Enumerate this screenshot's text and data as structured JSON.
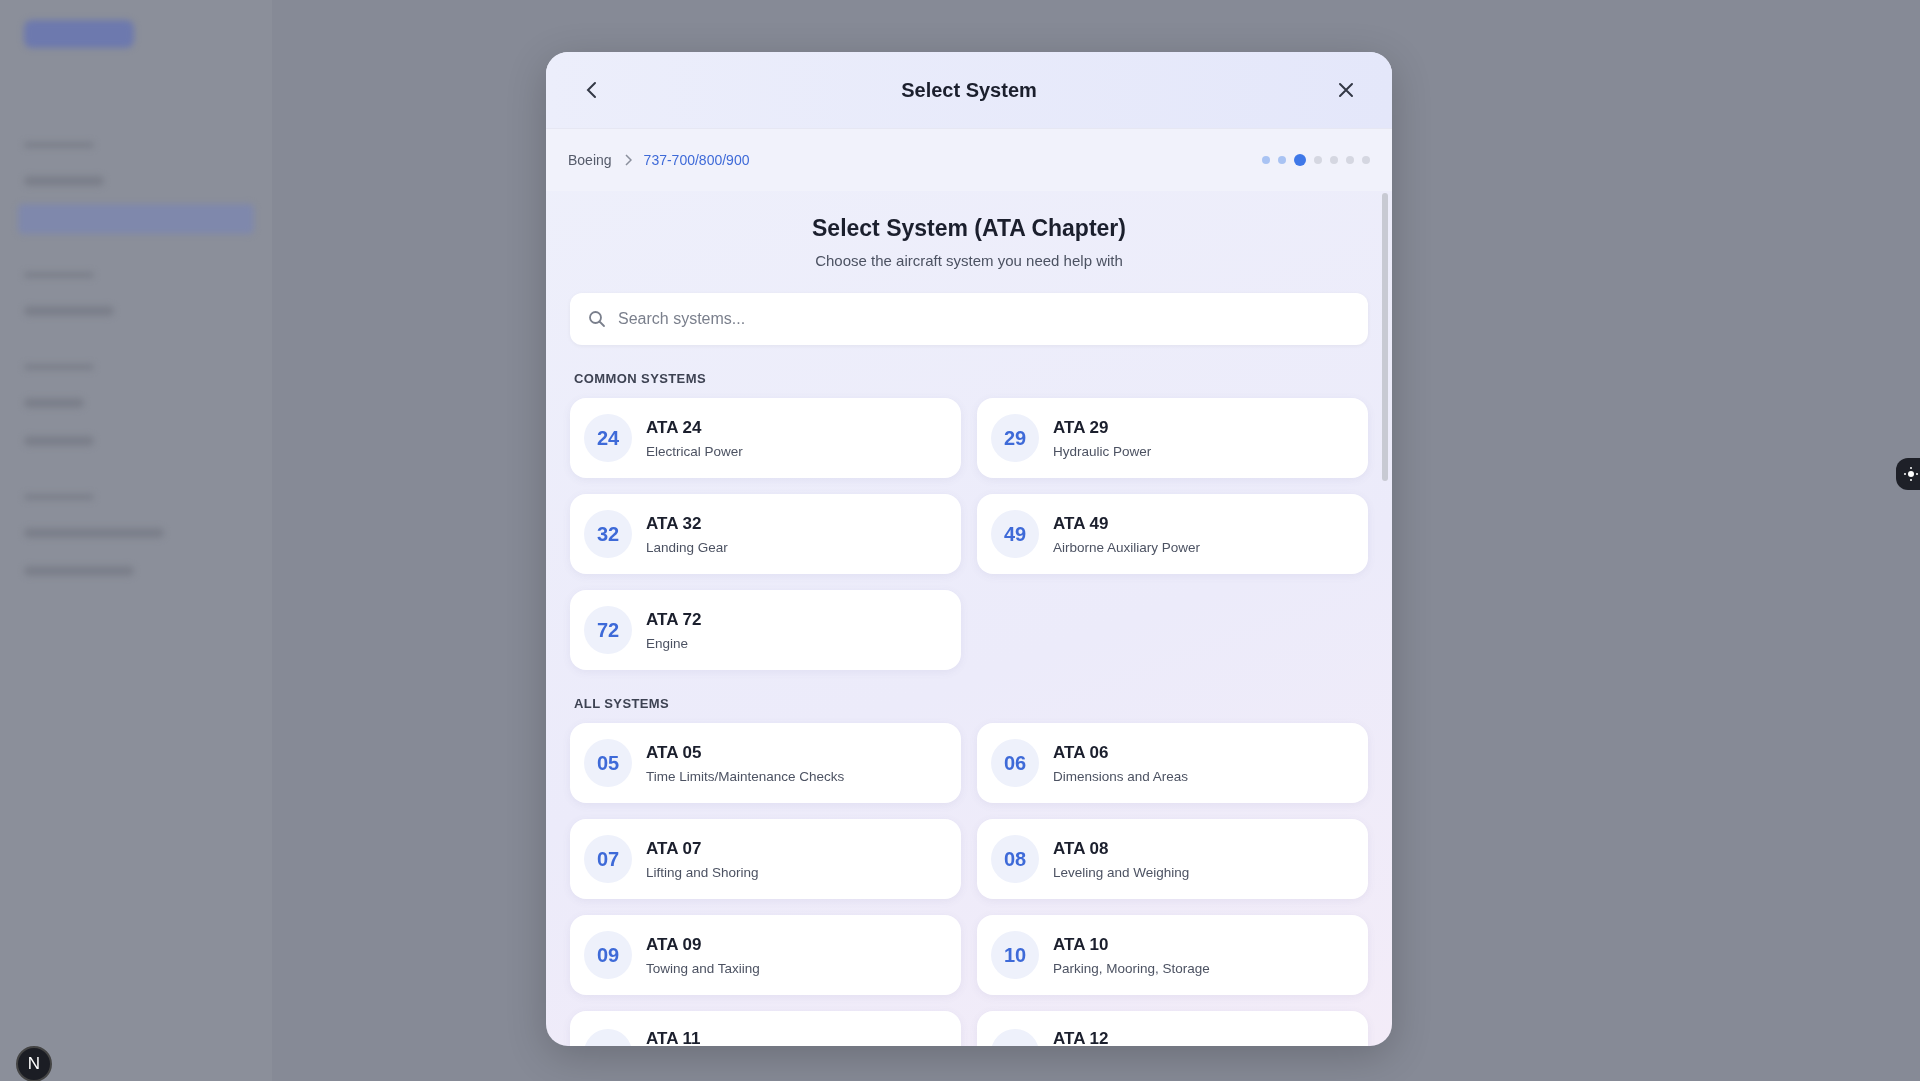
{
  "sidebar": {
    "avatar_initial": "N"
  },
  "modal": {
    "title": "Select System",
    "breadcrumb": [
      {
        "label": "Boeing",
        "selected": false
      },
      {
        "label": "737-700/800/900",
        "selected": true
      }
    ],
    "steps": [
      {
        "completed": true,
        "selected": false
      },
      {
        "completed": true,
        "selected": false
      },
      {
        "completed": false,
        "selected": true
      },
      {
        "completed": false,
        "selected": false
      },
      {
        "completed": false,
        "selected": false
      },
      {
        "completed": false,
        "selected": false
      },
      {
        "completed": false,
        "selected": false
      }
    ],
    "heading": "Select System (ATA Chapter)",
    "subheading": "Choose the aircraft system you need help with",
    "search": {
      "placeholder": "Search systems..."
    },
    "sections": [
      {
        "title": "COMMON SYSTEMS",
        "systems": [
          {
            "number": "24",
            "title": "ATA 24",
            "name": "Electrical Power"
          },
          {
            "number": "29",
            "title": "ATA 29",
            "name": "Hydraulic Power"
          },
          {
            "number": "32",
            "title": "ATA 32",
            "name": "Landing Gear"
          },
          {
            "number": "49",
            "title": "ATA 49",
            "name": "Airborne Auxiliary Power"
          },
          {
            "number": "72",
            "title": "ATA 72",
            "name": "Engine"
          }
        ]
      },
      {
        "title": "ALL SYSTEMS",
        "systems": [
          {
            "number": "05",
            "title": "ATA 05",
            "name": "Time Limits/Maintenance Checks"
          },
          {
            "number": "06",
            "title": "ATA 06",
            "name": "Dimensions and Areas"
          },
          {
            "number": "07",
            "title": "ATA 07",
            "name": "Lifting and Shoring"
          },
          {
            "number": "08",
            "title": "ATA 08",
            "name": "Leveling and Weighing"
          },
          {
            "number": "09",
            "title": "ATA 09",
            "name": "Towing and Taxiing"
          },
          {
            "number": "10",
            "title": "ATA 10",
            "name": "Parking, Mooring, Storage"
          },
          {
            "title": "ATA 11"
          },
          {
            "title": "ATA 12"
          }
        ]
      }
    ]
  }
}
